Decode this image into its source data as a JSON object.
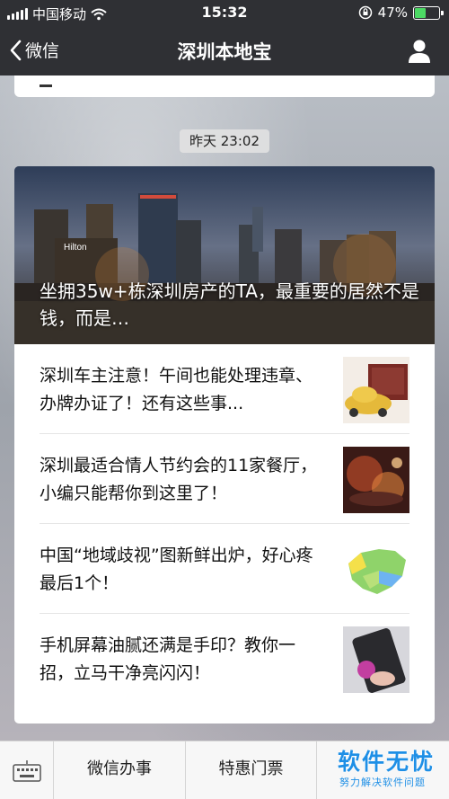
{
  "status_bar": {
    "carrier": "中国移动",
    "time": "15:32",
    "battery": "47%",
    "battery_level": 0.47,
    "icons": [
      "signal-icon",
      "wifi-icon",
      "orientation-lock-icon",
      "battery-icon"
    ]
  },
  "nav": {
    "back_label": "微信",
    "title": "深圳本地宝",
    "icons": [
      "chevron-left-icon",
      "user-icon"
    ]
  },
  "message": {
    "timestamp": "昨天 23:02",
    "hero_title": "坐拥35w+栋深圳房产的TA，最重要的居然不是钱，而是…",
    "hero_sign": "Hilton",
    "articles": [
      {
        "title": "深圳车主注意！午间也能处理违章、办牌办证了！还有这些事...",
        "thumb": "car-license-thumbnail"
      },
      {
        "title": "深圳最适合情人节约会的11家餐厅，小编只能帮你到这里了！",
        "thumb": "dinner-thumbnail"
      },
      {
        "title": "中国“地域歧视”图新鲜出炉，好心疼最后1个！",
        "thumb": "china-map-thumbnail"
      },
      {
        "title": "手机屏幕油腻还满是手印？教你一招，立马干净亮闪闪！",
        "thumb": "phone-screen-thumbnail"
      }
    ]
  },
  "bottom_menu": {
    "items": [
      "微信办事",
      "特惠门票"
    ],
    "icons": [
      "keyboard-icon"
    ]
  },
  "watermark": {
    "main": "软件无忧",
    "sub": "努力解决软件问题"
  },
  "colors": {
    "bar_dark": "#2f3034",
    "battery_green": "#4cd964",
    "watermark_blue": "#1e8fe6"
  }
}
